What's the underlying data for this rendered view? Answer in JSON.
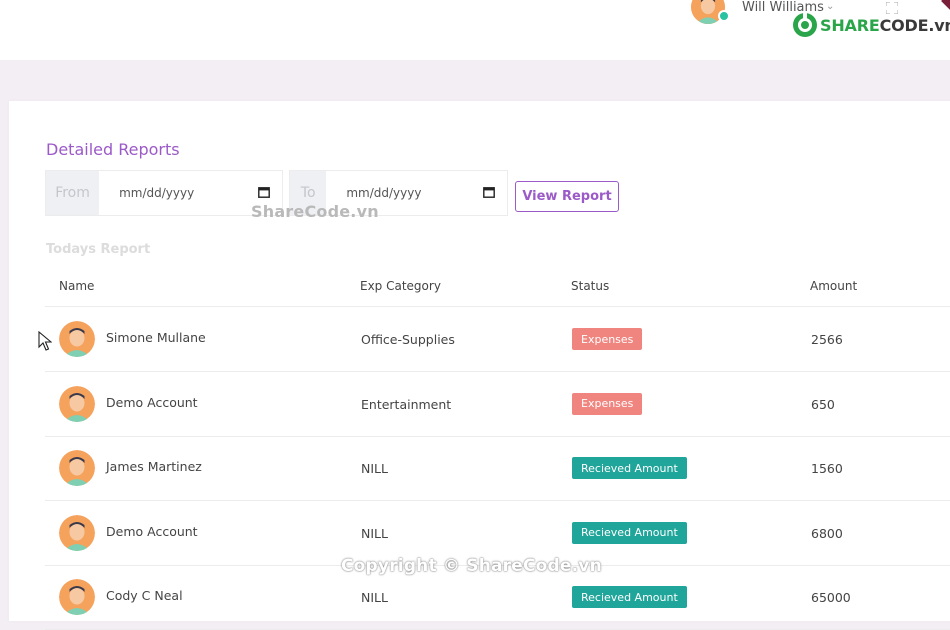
{
  "header": {
    "user_name": "Will Williams",
    "brand": {
      "part1": "SHARE",
      "part2": "CODE",
      "part3": ".vn"
    },
    "colors": {
      "status_dot": "#29c3a1"
    }
  },
  "report": {
    "title": "Detailed Reports",
    "from_label": "From",
    "to_label": "To",
    "from_placeholder": "mm/dd/yyyy",
    "to_placeholder": "mm/dd/yyyy",
    "view_button": "View Report",
    "section_label": "Todays Report",
    "watermark": "ShareCode.vn"
  },
  "table": {
    "columns": [
      "Name",
      "Exp Category",
      "Status",
      "Amount"
    ],
    "rows": [
      {
        "name": "Simone Mullane",
        "category": "Office-Supplies",
        "status": "Expenses",
        "status_type": "expense",
        "amount": "2566"
      },
      {
        "name": "Demo Account",
        "category": "Entertainment",
        "status": "Expenses",
        "status_type": "expense",
        "amount": "650"
      },
      {
        "name": "James Martinez",
        "category": "NILL",
        "status": "Recieved Amount",
        "status_type": "received",
        "amount": "1560"
      },
      {
        "name": "Demo Account",
        "category": "NILL",
        "status": "Recieved Amount",
        "status_type": "received",
        "amount": "6800"
      },
      {
        "name": "Cody C Neal",
        "category": "NILL",
        "status": "Recieved Amount",
        "status_type": "received",
        "amount": "65000"
      }
    ]
  },
  "colors": {
    "accent": "#9b5ac8",
    "expense": "#f0857f",
    "received": "#20a59a"
  },
  "footer": {
    "copyright": "Copyright © ShareCode.vn"
  }
}
